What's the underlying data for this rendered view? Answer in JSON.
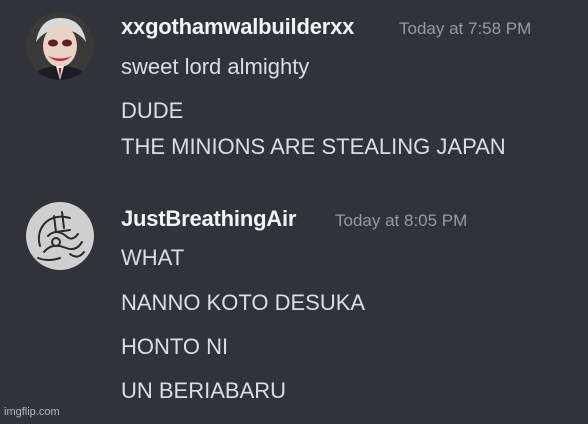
{
  "messages": [
    {
      "username": "xxgothamwalbuilderxx",
      "timestamp": "Today at 7:58 PM",
      "lines": [
        "sweet lord almighty",
        "DUDE",
        "THE MINIONS ARE STEALING JAPAN"
      ]
    },
    {
      "username": "JustBreathingAir",
      "timestamp": "Today at 8:05 PM",
      "lines": [
        "WHAT",
        "NANNO KOTO DESUKA",
        "HONTO NI",
        "UN BERIABARU"
      ]
    }
  ],
  "watermark": "imgflip.com",
  "colors": {
    "background": "#313338",
    "username": "#f2f3f5",
    "message_text": "#dbdee1",
    "timestamp": "#949ba4"
  }
}
